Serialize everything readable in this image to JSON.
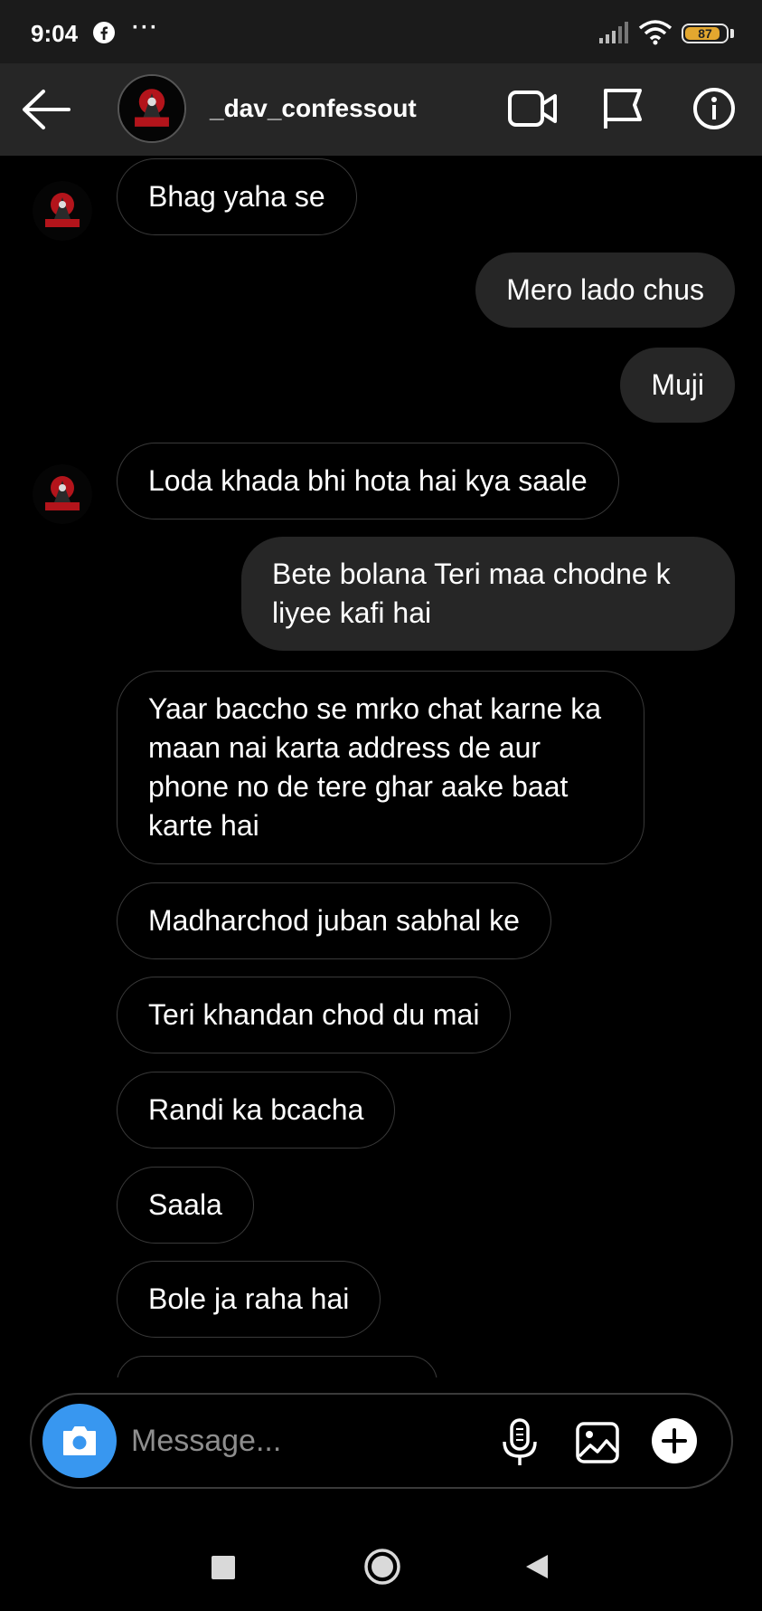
{
  "status_bar": {
    "time": "9:04",
    "more": "···",
    "battery": "87",
    "battery_level": 0.87
  },
  "header": {
    "username": "_dav_confessout",
    "icons": [
      "back-arrow-icon",
      "video-call-icon",
      "flag-icon",
      "info-icon"
    ]
  },
  "avatar_logo_text": "CONFESSOUT",
  "messages": [
    {
      "side": "in",
      "text": "Bhag yaha se",
      "avatar": true
    },
    {
      "side": "out",
      "text": "Mero lado chus"
    },
    {
      "side": "out",
      "text": "Muji"
    },
    {
      "side": "in",
      "text": "Loda khada bhi hota hai kya saale",
      "avatar": true
    },
    {
      "side": "out",
      "text": "Bete bolana Teri maa chodne k liyee kafi hai"
    },
    {
      "side": "in",
      "text": "Yaar baccho se mrko chat karne ka maan nai karta address de aur phone no de tere ghar aake baat karte hai"
    },
    {
      "side": "in",
      "text": "Madharchod juban sabhal ke"
    },
    {
      "side": "in",
      "text": "Teri khandan chod du mai"
    },
    {
      "side": "in",
      "text": "Randi ka bcacha"
    },
    {
      "side": "in",
      "text": "Saala"
    },
    {
      "side": "in",
      "text": "Bole ja raha hai"
    }
  ],
  "composer": {
    "placeholder": "Message...",
    "icons": [
      "camera-icon",
      "microphone-icon",
      "gallery-icon",
      "plus-icon"
    ]
  },
  "colors": {
    "header_bg": "#262626",
    "outgoing_bubble": "#262626",
    "incoming_border": "#3a3a3a",
    "camera_button": "#3897f0",
    "battery": "#e3a72f"
  }
}
